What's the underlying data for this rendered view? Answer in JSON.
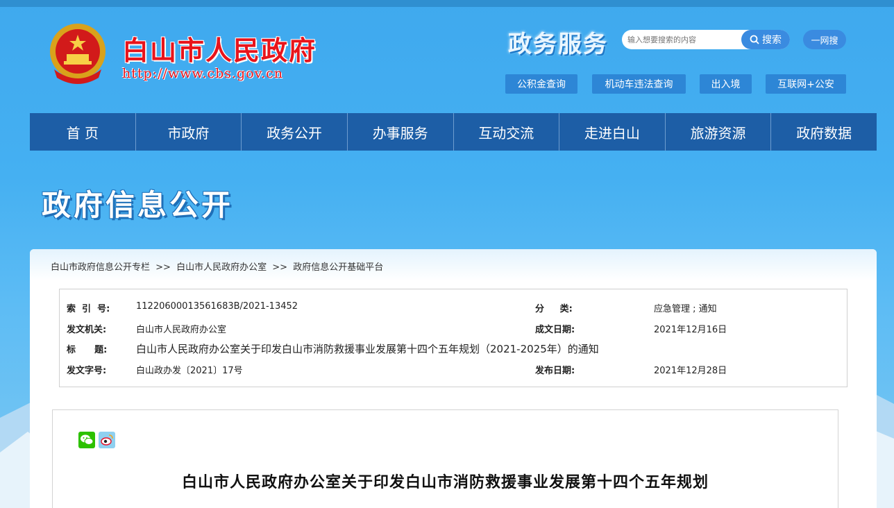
{
  "header": {
    "site_title": "白山市人民政府",
    "site_url": "http://www.cbs.gov.cn",
    "service_title": "政务服务",
    "search_placeholder": "输入想要搜索的内容",
    "search_button": "搜索",
    "yiwang_button": "一网搜",
    "quick_links": [
      "公积金查询",
      "机动车违法查询",
      "出入境",
      "互联网+公安"
    ]
  },
  "nav": [
    "首 页",
    "市政府",
    "政务公开",
    "办事服务",
    "互动交流",
    "走进白山",
    "旅游资源",
    "政府数据"
  ],
  "banner_title": "政府信息公开",
  "breadcrumb": [
    "白山市政府信息公开专栏",
    ">>",
    "白山市人民政府办公室",
    ">>",
    "政府信息公开基础平台"
  ],
  "meta": {
    "index_label": "索  引  号:",
    "index_value": "11220600013561683B/2021-13452",
    "category_label": "分     类:",
    "category_value": "应急管理 ; 通知",
    "issuer_label": "发文机关:",
    "issuer_value": "白山市人民政府办公室",
    "written_date_label": "成文日期:",
    "written_date_value": "2021年12月16日",
    "title_label": "标      题:",
    "title_value": "白山市人民政府办公室关于印发白山市消防救援事业发展第十四个五年规划（2021-2025年）的通知",
    "doc_number_label": "发文字号:",
    "doc_number_value": "白山政办发〔2021〕17号",
    "publish_date_label": "发布日期:",
    "publish_date_value": "2021年12月28日"
  },
  "article": {
    "title": "白山市人民政府办公室关于印发白山市消防救援事业发展第十四个五年规划"
  },
  "colors": {
    "nav_bg": "#1d5ea6",
    "title_red": "#e8141b",
    "button_blue": "#3a8be0"
  }
}
